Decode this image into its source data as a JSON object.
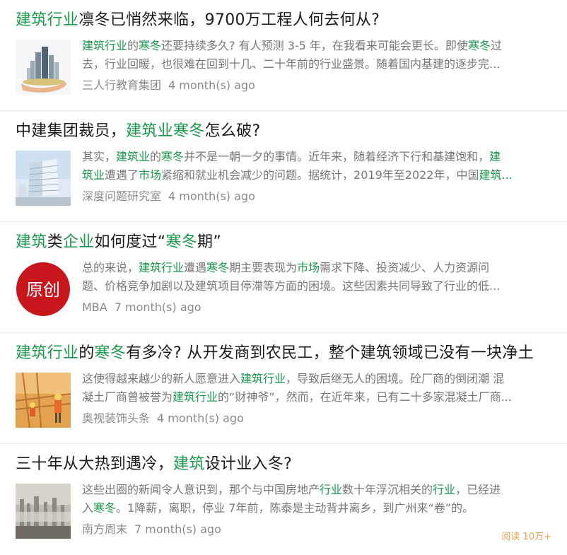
{
  "results": [
    {
      "title": [
        {
          "t": "建筑行业",
          "hl": true
        },
        {
          "t": "凛冬已悄然来临，9700万工程人何去何从?",
          "hl": false
        }
      ],
      "snippet_lines": [
        [
          {
            "t": "建筑行业",
            "hl": true
          },
          {
            "t": "的",
            "hl": false
          },
          {
            "t": "寒冬",
            "hl": true
          },
          {
            "t": "还要持续多久? 有人预测 3-5 年，在我看来可能会更长。即使",
            "hl": false
          },
          {
            "t": "寒冬",
            "hl": true
          },
          {
            "t": "过",
            "hl": false
          }
        ],
        [
          {
            "t": "去，行业回暖，也很难在回到十几、二十年前的行业盛景。随着国内基建的逐步完...",
            "hl": false
          }
        ]
      ],
      "source": "三人行教育集团",
      "time": "4 month(s) ago",
      "thumb": "city-skyline-hand"
    },
    {
      "title": [
        {
          "t": "中建集团裁员，",
          "hl": false
        },
        {
          "t": "建筑业寒冬",
          "hl": true
        },
        {
          "t": "怎么破?",
          "hl": false
        }
      ],
      "snippet_lines": [
        [
          {
            "t": "其实，",
            "hl": false
          },
          {
            "t": "建筑业",
            "hl": true
          },
          {
            "t": "的",
            "hl": false
          },
          {
            "t": "寒冬",
            "hl": true
          },
          {
            "t": "并不是一朝一夕的事情。近年来，随着经济下行和基建饱和，",
            "hl": false
          },
          {
            "t": "建",
            "hl": true
          }
        ],
        [
          {
            "t": "筑业",
            "hl": true
          },
          {
            "t": "遭遇了",
            "hl": false
          },
          {
            "t": "市场",
            "hl": true
          },
          {
            "t": "紧缩和就业机会减少的问题。据统计，2019年至2022年，中国",
            "hl": false
          },
          {
            "t": "建筑...",
            "hl": true
          }
        ]
      ],
      "source": "深度问题研究室",
      "time": "4 month(s) ago",
      "thumb": "office-building"
    },
    {
      "title": [
        {
          "t": "建筑",
          "hl": true
        },
        {
          "t": "类",
          "hl": false
        },
        {
          "t": "企业",
          "hl": true
        },
        {
          "t": "如何度过“",
          "hl": false
        },
        {
          "t": "寒冬",
          "hl": true
        },
        {
          "t": "期”",
          "hl": false
        }
      ],
      "snippet_lines": [
        [
          {
            "t": "总的来说，",
            "hl": false
          },
          {
            "t": "建筑行业",
            "hl": true
          },
          {
            "t": "遭遇",
            "hl": false
          },
          {
            "t": "寒冬",
            "hl": true
          },
          {
            "t": "期主要表现为",
            "hl": false
          },
          {
            "t": "市场",
            "hl": true
          },
          {
            "t": "需求下降、投资减少、人力资源问",
            "hl": false
          }
        ],
        [
          {
            "t": "题、价格竞争加剧以及建筑项目停滞等方面的困境。这些因素共同导致了行业的低...",
            "hl": false
          }
        ]
      ],
      "source": "MBA",
      "time": "7 month(s) ago",
      "thumb": "original-badge",
      "badge_text": "原创"
    },
    {
      "title": [
        {
          "t": "建筑行业",
          "hl": true
        },
        {
          "t": "的",
          "hl": false
        },
        {
          "t": "寒冬",
          "hl": true
        },
        {
          "t": "有多冷? 从开发商到农民工，整个建筑领域已没有一块净土",
          "hl": false
        }
      ],
      "snippet_lines": [
        [
          {
            "t": "这使得越来越少的新人愿意进入",
            "hl": false
          },
          {
            "t": "建筑行业",
            "hl": true
          },
          {
            "t": "，导致后继无人的困境。砼厂商的倒闭潮 混",
            "hl": false
          }
        ],
        [
          {
            "t": "凝土厂商曾被誉为",
            "hl": false
          },
          {
            "t": "建筑行业",
            "hl": true
          },
          {
            "t": "的“财神爷”，然而，在近年来，已有二十多家混凝土厂商...",
            "hl": false
          }
        ]
      ],
      "source": "奥视装饰头条",
      "time": "4 month(s) ago",
      "thumb": "construction-worker"
    },
    {
      "title": [
        {
          "t": "三十年从大热到遇冷，",
          "hl": false
        },
        {
          "t": "建筑",
          "hl": true
        },
        {
          "t": "设计业入冬?",
          "hl": false
        }
      ],
      "snippet_lines": [
        [
          {
            "t": "这些出圈的新闻令人意识到，那个与中国房地产",
            "hl": false
          },
          {
            "t": "行业",
            "hl": true
          },
          {
            "t": "数十年浮沉相关的",
            "hl": false
          },
          {
            "t": "行业",
            "hl": true
          },
          {
            "t": "，已经进",
            "hl": false
          }
        ],
        [
          {
            "t": "入",
            "hl": false
          },
          {
            "t": "寒冬",
            "hl": true
          },
          {
            "t": "。1降薪，离职，停业 7年前，陈泰是主动背井离乡，到广州来“卷”的。",
            "hl": false
          }
        ]
      ],
      "source": "南方周末",
      "time": "7 month(s) ago",
      "thumb": "foggy-city",
      "reads": "阅读 10万+"
    }
  ],
  "colors": {
    "highlight": "#17984a",
    "snippet": "#777777",
    "meta": "#8a8a8a",
    "reads": "#e3a04a",
    "badge": "#c8161d"
  }
}
